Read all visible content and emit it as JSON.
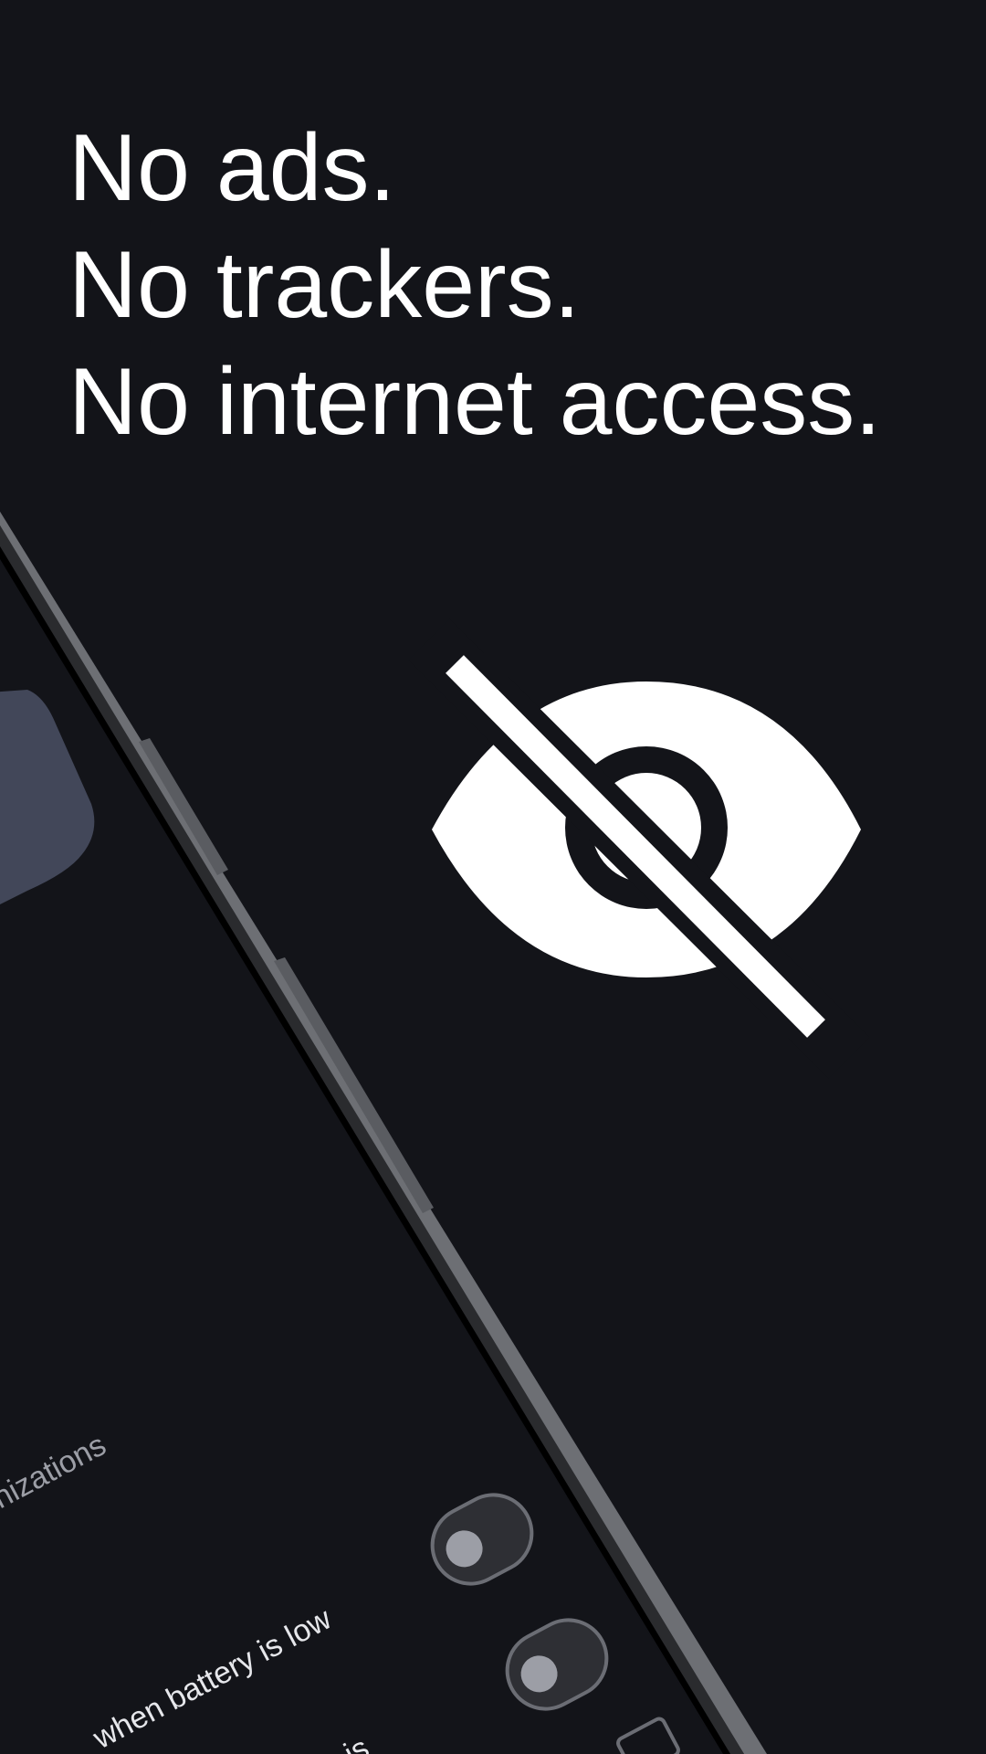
{
  "headline": {
    "line1": "No ads.",
    "line2": "No trackers.",
    "line3": "No internet access."
  },
  "hero_icon": "eye-off-icon",
  "phone_screen": {
    "partial_label_1": "nizations",
    "partial_label_2": "when battery is low",
    "partial_label_3": "is",
    "toggles": [
      {
        "state": "off"
      },
      {
        "state": "off"
      }
    ]
  },
  "colors": {
    "background": "#131419",
    "text": "#ffffff",
    "card": "#424759",
    "toggle_track": "#2e2f34",
    "toggle_knob": "#9c9ea6"
  }
}
